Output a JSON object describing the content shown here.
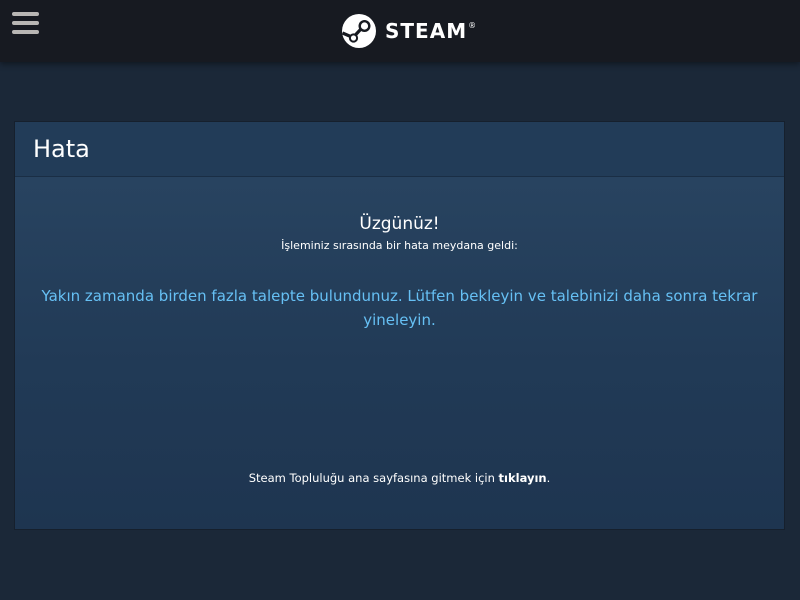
{
  "header": {
    "menu_icon": "hamburger-menu-icon",
    "logo_icon": "steam-logo-icon",
    "logo_text": "STEAM",
    "logo_tm": "®"
  },
  "panel": {
    "title": "Hata",
    "sorry": "Üzgünüz!",
    "subtitle": "İşleminiz sırasında bir hata meydana geldi:",
    "error_message": "Yakın zamanda birden fazla talepte bulundunuz. Lütfen bekleyin ve talebinizi daha sonra tekrar yineleyin.",
    "footer_prefix": "Steam Topluluğu ana sayfasına gitmek için ",
    "footer_link": "tıklayın",
    "footer_suffix": "."
  },
  "colors": {
    "background": "#1b2838",
    "topbar": "#171a21",
    "link_blue": "#66c0f4",
    "panel": "#2a4663"
  }
}
